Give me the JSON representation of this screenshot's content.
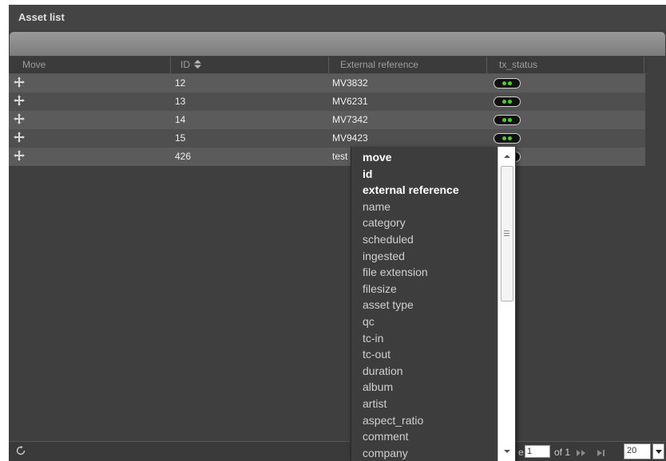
{
  "panel": {
    "title": "Asset list"
  },
  "columns": {
    "move": "Move",
    "id": "ID",
    "external_reference": "External reference",
    "tx_status": "tx_status"
  },
  "rows": [
    {
      "id": "12",
      "ext_ref": "MV3832",
      "status": "green"
    },
    {
      "id": "13",
      "ext_ref": "MV6231",
      "status": "green"
    },
    {
      "id": "14",
      "ext_ref": "MV7342",
      "status": "green"
    },
    {
      "id": "15",
      "ext_ref": "MV9423",
      "status": "green"
    },
    {
      "id": "426",
      "ext_ref": "test",
      "status": "green"
    }
  ],
  "column_chooser": {
    "options": [
      {
        "label": "move",
        "selected": true
      },
      {
        "label": "id",
        "selected": true
      },
      {
        "label": "external reference",
        "selected": true
      },
      {
        "label": "name",
        "selected": false
      },
      {
        "label": "category",
        "selected": false
      },
      {
        "label": "scheduled",
        "selected": false
      },
      {
        "label": "ingested",
        "selected": false
      },
      {
        "label": "file extension",
        "selected": false
      },
      {
        "label": "filesize",
        "selected": false
      },
      {
        "label": "asset type",
        "selected": false
      },
      {
        "label": "qc",
        "selected": false
      },
      {
        "label": "tc-in",
        "selected": false
      },
      {
        "label": "tc-out",
        "selected": false
      },
      {
        "label": "duration",
        "selected": false
      },
      {
        "label": "album",
        "selected": false
      },
      {
        "label": "artist",
        "selected": false
      },
      {
        "label": "aspect_ratio",
        "selected": false
      },
      {
        "label": "comment",
        "selected": false
      },
      {
        "label": "company",
        "selected": false
      }
    ]
  },
  "footer": {
    "page_label": "e",
    "page_value": "1",
    "of_label": "of 1",
    "per_page": "20"
  },
  "colors": {
    "status_green": "#4ad028",
    "row_odd": "#5b5b5b",
    "row_even": "#4f4f4f"
  },
  "icons": {
    "move": "move-arrows-icon",
    "sort": "sort-icon",
    "refresh": "refresh-icon",
    "next": "next-page-icon",
    "last": "last-page-icon"
  }
}
